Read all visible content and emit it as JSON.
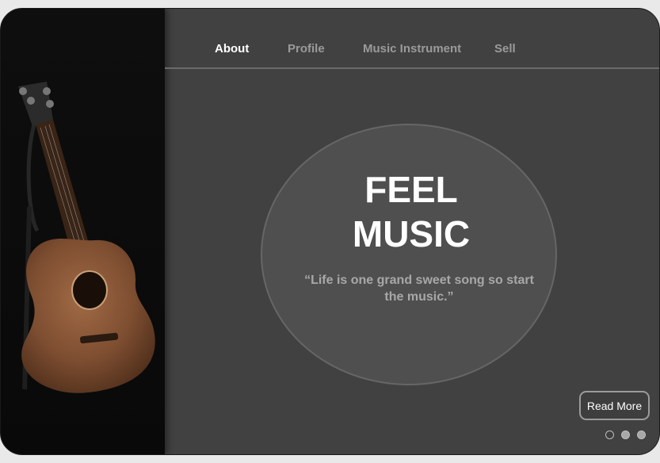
{
  "nav": {
    "items": [
      {
        "label": "About",
        "active": true
      },
      {
        "label": "Profile",
        "active": false
      },
      {
        "label": "Music Instrument",
        "active": false
      },
      {
        "label": "Sell",
        "active": false
      }
    ]
  },
  "hero": {
    "title_line1": "FEEL",
    "title_line2": "MUSIC",
    "quote": "“Life is one grand sweet song so start the music.”"
  },
  "cta": {
    "read_more_label": "Read More"
  },
  "carousel": {
    "dots": [
      false,
      true,
      true
    ]
  },
  "side_image": {
    "subject": "acoustic guitar"
  },
  "colors": {
    "background": "#414141",
    "sidebar": "#0b0b0b",
    "accent_text": "#ffffff",
    "muted_text": "#9a9a9a",
    "wood": "#8a5a3c"
  }
}
